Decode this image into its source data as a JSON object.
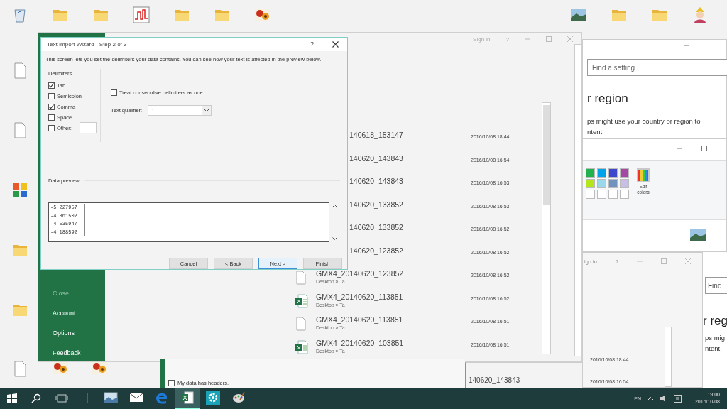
{
  "desktop": {
    "top_left_icons": [
      {
        "kind": "recycle-bin"
      },
      {
        "kind": "folder"
      },
      {
        "kind": "folder"
      },
      {
        "kind": "chart"
      },
      {
        "kind": "folder"
      },
      {
        "kind": "folder"
      },
      {
        "kind": "flowers"
      }
    ],
    "top_right_icons": [
      {
        "kind": "landscape"
      },
      {
        "kind": "folder"
      },
      {
        "kind": "folder"
      },
      {
        "kind": "character"
      }
    ],
    "left_icons": [
      {
        "kind": "document"
      },
      {
        "kind": "document"
      },
      {
        "kind": "app"
      },
      {
        "kind": "folder"
      },
      {
        "kind": "folder"
      },
      {
        "kind": "document"
      }
    ],
    "bottom_icons": [
      {
        "kind": "flowers"
      },
      {
        "kind": "flowers"
      }
    ]
  },
  "excel": {
    "header": {
      "sign_in": "Sign in",
      "help": "?"
    },
    "backstage": [
      {
        "label": "Close",
        "disabled": true
      },
      {
        "label": "Account",
        "disabled": false
      },
      {
        "label": "Options",
        "disabled": false
      },
      {
        "label": "Feedback",
        "disabled": false
      }
    ],
    "files": [
      {
        "kind": "clipped",
        "name": "140618_153147",
        "date": "2016/10/08 18:44"
      },
      {
        "kind": "clipped",
        "name": "140620_143843",
        "date": "2016/10/08 16:54"
      },
      {
        "kind": "clipped",
        "name": "140620_143843",
        "date": "2016/10/08 16:53"
      },
      {
        "kind": "clipped",
        "name": "140620_133852",
        "date": "2016/10/08 16:53"
      },
      {
        "kind": "clipped",
        "name": "140620_133852",
        "date": "2016/10/08 16:52"
      },
      {
        "kind": "clipped",
        "name": "140620_123852",
        "date": "2016/10/08 16:52"
      },
      {
        "kind": "file",
        "name": "GMX4_20140620_123852",
        "location": "Desktop » Ta",
        "date": "2016/10/08 16:52"
      },
      {
        "kind": "excel",
        "name": "GMX4_20140620_113851",
        "location": "Desktop » Ta",
        "date": "2016/10/08 16:52"
      },
      {
        "kind": "file",
        "name": "GMX4_20140620_113851",
        "location": "Desktop » Ta",
        "date": "2016/10/08 16:51"
      },
      {
        "kind": "excel",
        "name": "GMX4_20140620_103851",
        "location": "Desktop » Ta",
        "date": "2016/10/08 16:51"
      }
    ]
  },
  "wizard": {
    "title": "Text Import Wizard - Step 2 of 3",
    "help": "?",
    "description": "This screen lets you set the delimiters your data contains.  You can see how your text is affected in the preview below.",
    "delimiters_label": "Delimiters",
    "delimiters": [
      {
        "label": "Tab",
        "checked": true
      },
      {
        "label": "Semicolon",
        "checked": false
      },
      {
        "label": "Comma",
        "checked": true
      },
      {
        "label": "Space",
        "checked": false
      },
      {
        "label": "Other:",
        "checked": false
      }
    ],
    "consecutive": {
      "label": "Treat consecutive delimiters as one",
      "checked": false
    },
    "text_qualifier": {
      "label": "Text qualifier:",
      "value": "\""
    },
    "preview_label": "Data preview",
    "preview_rows": [
      "-5.227957",
      "-4.861502",
      "-4.535947",
      "-4.188592"
    ],
    "buttons": [
      {
        "label": "Cancel",
        "selected": false
      },
      {
        "label": "< Back",
        "selected": false
      },
      {
        "label": "Next >",
        "selected": true
      },
      {
        "label": "Finish",
        "selected": false
      }
    ]
  },
  "back_wizard": {
    "headers_checkbox": {
      "label": "My data has headers.",
      "checked": false
    }
  },
  "file_window": {
    "name": "140620_143843"
  },
  "settings_top": {
    "search_placeholder": "Find a setting",
    "heading": "r region",
    "lines": [
      "ps might use your country or region to",
      "ntent"
    ]
  },
  "paint": {
    "edit_colors": "Edit colors",
    "swatches": [
      {
        "color": "#22b14c"
      },
      {
        "color": "#00a2e8"
      },
      {
        "color": "#3f48cc"
      },
      {
        "color": "#a349a4"
      },
      {
        "color": "#b5e61d"
      },
      {
        "color": "#99d9ea"
      },
      {
        "color": "#7092be"
      },
      {
        "color": "#c8bfe7"
      },
      {
        "color": "#ffffff"
      },
      {
        "color": "#ffffff"
      },
      {
        "color": "#ffffff"
      },
      {
        "color": "#ffffff"
      }
    ]
  },
  "bottom_right": {
    "sign_in": "ign in",
    "help": "?",
    "dates": [
      "2016/10/08 18:44",
      "2016/10/08 16:54"
    ],
    "search_placeholder": "Find",
    "heading": "r reg",
    "lines": [
      "ps mig",
      "ntent"
    ]
  },
  "taskbar": {
    "apps": [
      {
        "kind": "photos",
        "selected": false
      },
      {
        "kind": "mail",
        "selected": false
      },
      {
        "kind": "edge",
        "selected": false
      },
      {
        "kind": "excel",
        "selected": true
      },
      {
        "kind": "settings",
        "selected": false
      },
      {
        "kind": "paint",
        "selected": false
      }
    ],
    "language": "EN",
    "time": "19:00",
    "date": "2016/10/08"
  }
}
